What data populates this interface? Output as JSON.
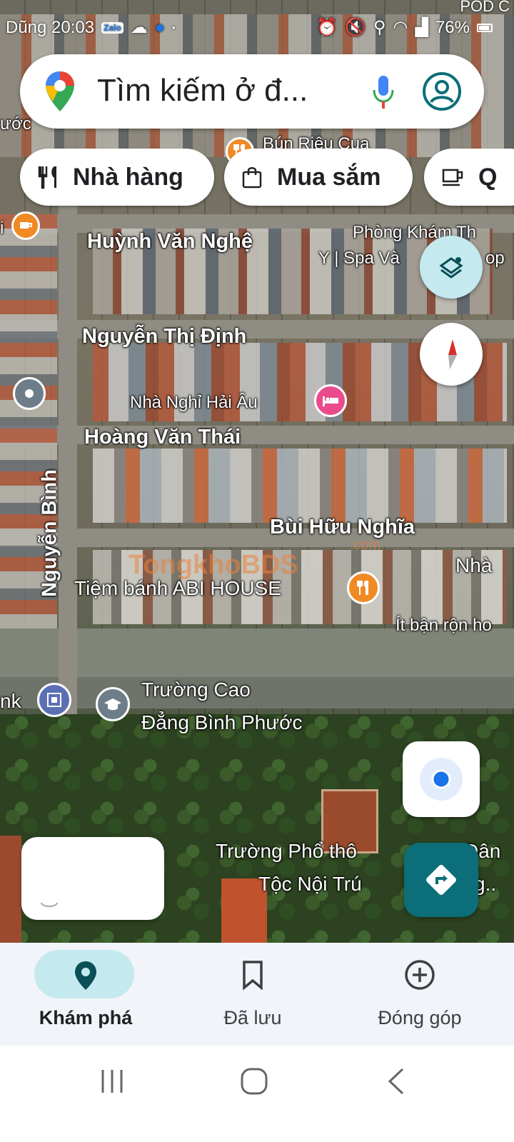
{
  "status_bar": {
    "time": "Dũng 20:03",
    "left_icons": [
      "zalo-icon",
      "weather-icon",
      "messenger-icon",
      "dot-icon"
    ],
    "right_icons": [
      "alarm-icon",
      "mute-icon",
      "location-icon",
      "wifi-icon",
      "signal-icon"
    ],
    "battery": "76%",
    "corner_text": "POD C"
  },
  "search": {
    "placeholder": "Tìm kiếm ở đ..."
  },
  "chips": [
    {
      "label": "Nhà hàng",
      "icon": "restaurant-icon"
    },
    {
      "label": "Mua sắm",
      "icon": "shopping-bag-icon"
    },
    {
      "label": "Q",
      "icon": "coffee-icon"
    }
  ],
  "map": {
    "streets": {
      "huynh_van_nghe": "Huỳnh Văn Nghệ",
      "nguyen_thi_dinh": "Nguyễn Thị Định",
      "hoang_van_thai": "Hoàng Văn Thái",
      "bui_huu_nghia": "Bùi Hữu Nghĩa",
      "nguyen_binh": "Nguyễn Bình"
    },
    "places": {
      "bun_rieu": "Bún Riêu Cua",
      "phong_kham_1": "Phòng Khám Th",
      "phong_kham_2": "Y | Spa Và",
      "phong_kham_3": "op",
      "nha_nghi": "Nhà Nghỉ Hải Âu",
      "tiem_banh": "Tiệm bánh ABI HOUSE",
      "nha": "Nhà",
      "it_ban_ron": "Ít bận rộn ho",
      "truong_cao_dang_1": "Trường Cao",
      "truong_cao_dang_2": "Đẳng Bình Phước",
      "nk": "nk",
      "phuoc": "ước",
      "i": "i",
      "truong_pho_thong_1": "Trường Phổ thô",
      "truong_pho_thong_1b": "Dân",
      "truong_pho_thong_2": "Tộc Nội Trú",
      "truong_pho_thong_2b": "g.."
    },
    "watermark": "TongkhoBDS",
    "watermark_sub": ".com"
  },
  "bottom_nav": {
    "items": [
      {
        "label": "Khám phá",
        "icon": "explore-pin-icon",
        "active": true
      },
      {
        "label": "Đã lưu",
        "icon": "bookmark-icon",
        "active": false
      },
      {
        "label": "Đóng góp",
        "icon": "add-circle-icon",
        "active": false
      }
    ]
  },
  "colors": {
    "accent": "#0b6e78",
    "active_pill": "#c4eaf0",
    "nav_bg": "#f1f4f9",
    "restaurant_pin": "#f08a24",
    "hotel_pin": "#e94b8c",
    "school_pin": "#5b6fb3"
  }
}
